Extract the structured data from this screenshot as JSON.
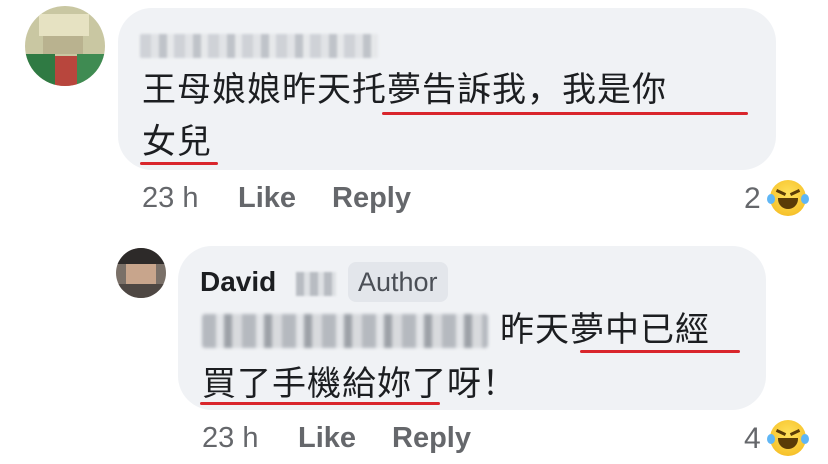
{
  "comments": [
    {
      "text_lines": [
        "王母娘娘昨天托夢告訴我，我是你",
        "女兒"
      ],
      "time": "23 h",
      "like_label": "Like",
      "reply_label": "Reply",
      "reaction_count": "2",
      "reaction_icon": "haha-emoji-icon"
    },
    {
      "author_first_name": "David",
      "author_badge": "Author",
      "text_line_1": "昨天夢中已經",
      "text_line_2": "買了手機給妳了呀！",
      "time": "23 h",
      "like_label": "Like",
      "reply_label": "Reply",
      "reaction_count": "4",
      "reaction_icon": "haha-emoji-icon"
    }
  ],
  "colors": {
    "bubble_bg": "#f0f2f5",
    "underline": "#d9262c",
    "meta_text": "#65676b",
    "badge_bg": "#e3e6eb"
  }
}
